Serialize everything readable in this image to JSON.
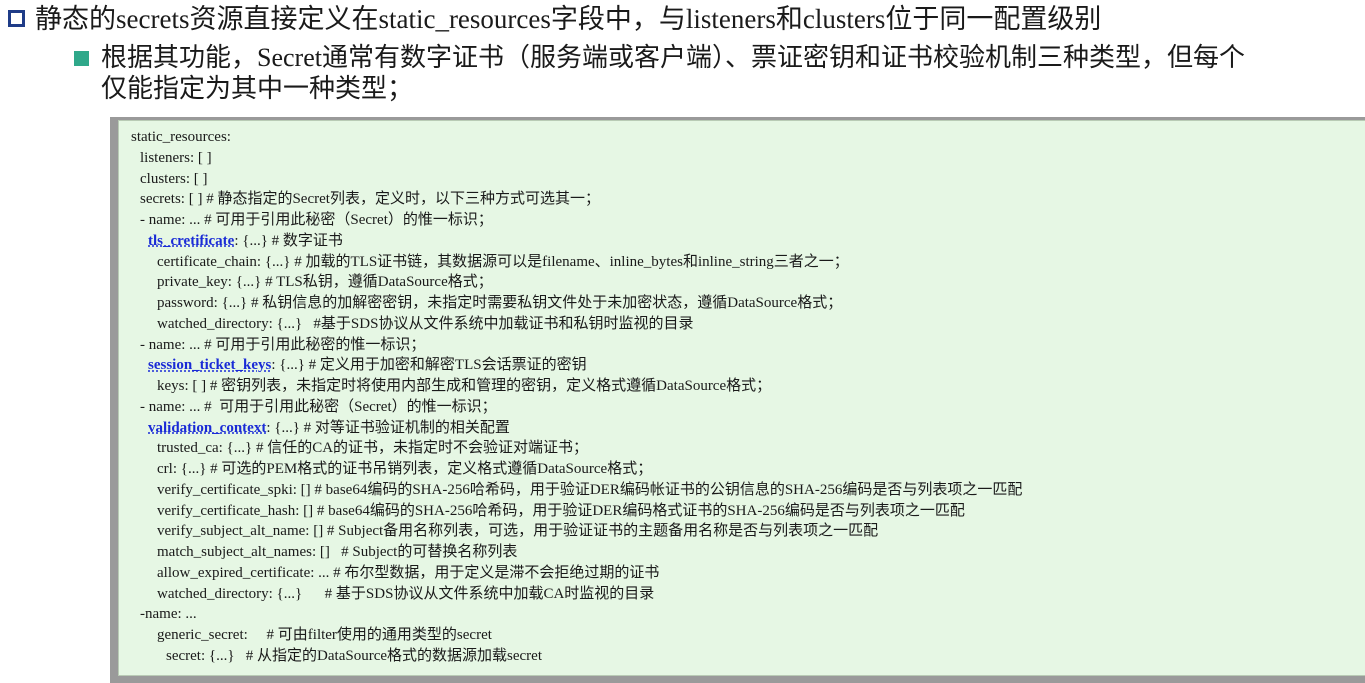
{
  "heading": {
    "text": "静态的secrets资源直接定义在static_resources字段中，与listeners和clusters位于同一配置级别"
  },
  "sub_bullet": {
    "line1": "根据其功能，Secret通常有数字证书（服务端或客户端）、票证密钥和证书校验机制三种类型，但每个",
    "line2": "仅能指定为其中一种类型；"
  },
  "code": {
    "lines": [
      {
        "indent": 12,
        "pre": "static_resources:",
        "kw": "",
        "post": ""
      },
      {
        "indent": 21,
        "pre": "listeners: [ ]",
        "kw": "",
        "post": ""
      },
      {
        "indent": 21,
        "pre": "clusters: [ ]",
        "kw": "",
        "post": ""
      },
      {
        "indent": 21,
        "pre": "secrets: [ ] # 静态指定的Secret列表，定义时，以下三种方式可选其一；",
        "kw": "",
        "post": ""
      },
      {
        "indent": 21,
        "pre": "- name: ... # 可用于引用此秘密（Secret）的惟一标识；",
        "kw": "",
        "post": ""
      },
      {
        "indent": 29,
        "pre": "",
        "kw": "tls_cretificate",
        "post": ": {...} # 数字证书"
      },
      {
        "indent": 38,
        "pre": "certificate_chain: {...} # 加载的TLS证书链，其数据源可以是filename、inline_bytes和inline_string三者之一；",
        "kw": "",
        "post": ""
      },
      {
        "indent": 38,
        "pre": "private_key: {...} # TLS私钥，遵循DataSource格式；",
        "kw": "",
        "post": ""
      },
      {
        "indent": 38,
        "pre": "password: {...} # 私钥信息的加解密密钥，未指定时需要私钥文件处于未加密状态，遵循DataSource格式；",
        "kw": "",
        "post": ""
      },
      {
        "indent": 38,
        "pre": "watched_directory: {...}   #基于SDS协议从文件系统中加载证书和私钥时监视的目录",
        "kw": "",
        "post": ""
      },
      {
        "indent": 21,
        "pre": "- name: ... # 可用于引用此秘密的惟一标识；",
        "kw": "",
        "post": ""
      },
      {
        "indent": 29,
        "pre": "",
        "kw": "session_ticket_keys",
        "post": ": {...} # 定义用于加密和解密TLS会话票证的密钥"
      },
      {
        "indent": 38,
        "pre": "keys: [ ] # 密钥列表，未指定时将使用内部生成和管理的密钥，定义格式遵循DataSource格式；",
        "kw": "",
        "post": ""
      },
      {
        "indent": 21,
        "pre": "- name: ... #  可用于引用此秘密（Secret）的惟一标识；",
        "kw": "",
        "post": ""
      },
      {
        "indent": 29,
        "pre": "",
        "kw": "validation_context",
        "post": ": {...} # 对等证书验证机制的相关配置"
      },
      {
        "indent": 38,
        "pre": "trusted_ca: {...} # 信任的CA的证书，未指定时不会验证对端证书；",
        "kw": "",
        "post": ""
      },
      {
        "indent": 38,
        "pre": "crl: {...} # 可选的PEM格式的证书吊销列表，定义格式遵循DataSource格式；",
        "kw": "",
        "post": ""
      },
      {
        "indent": 38,
        "pre": "verify_certificate_spki: [] # base64编码的SHA-256哈希码，用于验证DER编码帐证书的公钥信息的SHA-256编码是否与列表项之一匹配",
        "kw": "",
        "post": ""
      },
      {
        "indent": 38,
        "pre": "verify_certificate_hash: [] # base64编码的SHA-256哈希码，用于验证DER编码格式证书的SHA-256编码是否与列表项之一匹配",
        "kw": "",
        "post": ""
      },
      {
        "indent": 38,
        "pre": "verify_subject_alt_name: [] # Subject备用名称列表，可选，用于验证证书的主题备用名称是否与列表项之一匹配",
        "kw": "",
        "post": ""
      },
      {
        "indent": 38,
        "pre": "match_subject_alt_names: []   # Subject的可替换名称列表",
        "kw": "",
        "post": ""
      },
      {
        "indent": 38,
        "pre": "allow_expired_certificate: ... # 布尔型数据，用于定义是滞不会拒绝过期的证书",
        "kw": "",
        "post": ""
      },
      {
        "indent": 38,
        "pre": "watched_directory: {...}      # 基于SDS协议从文件系统中加载CA时监视的目录",
        "kw": "",
        "post": ""
      },
      {
        "indent": 21,
        "pre": "-name: ...",
        "kw": "",
        "post": ""
      },
      {
        "indent": 38,
        "pre": "generic_secret:     # 可由filter使用的通用类型的secret",
        "kw": "",
        "post": ""
      },
      {
        "indent": 47,
        "pre": "secret: {...}   # 从指定的DataSource格式的数据源加载secret",
        "kw": "",
        "post": ""
      }
    ]
  }
}
